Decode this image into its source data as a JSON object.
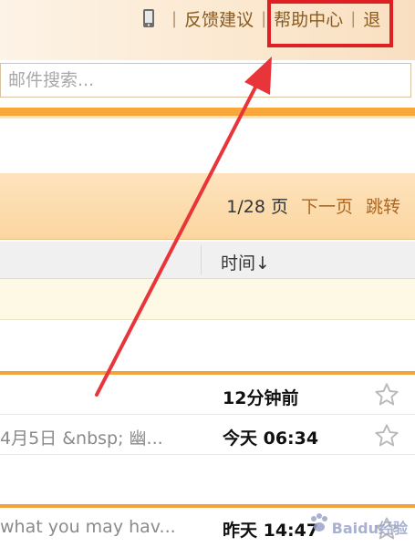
{
  "header": {
    "feedback_label": "反馈建议",
    "help_label": "帮助中心",
    "logout_partial": "退",
    "separator": "|",
    "help_box_color": "#e01f24"
  },
  "search": {
    "placeholder": "邮件搜索..."
  },
  "pager": {
    "count": "1/28 页",
    "next_label": "下一页",
    "jump_label": "跳转"
  },
  "columns": {
    "time_label": "时间↓"
  },
  "mails": [
    {
      "preview": "",
      "time": "12分钟前",
      "starred": false
    },
    {
      "preview": "4月5日 &nbsp; 幽...",
      "time": "今天 06:34",
      "starred": false
    },
    {
      "preview": "what you may hav...",
      "time": "昨天 14:47",
      "starred": false
    }
  ],
  "watermark": {
    "text": "Baidu经验"
  },
  "colors": {
    "accent": "#f8a83a",
    "link": "#b2651c",
    "annotation_arrow": "#e8353a"
  }
}
